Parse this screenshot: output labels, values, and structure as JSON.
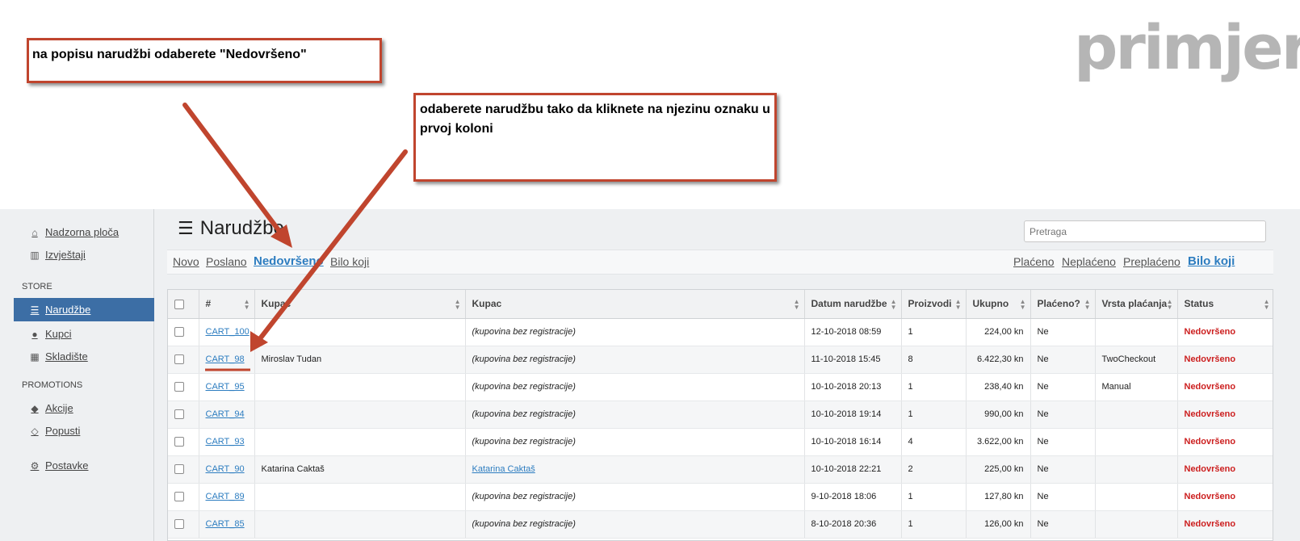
{
  "annotations": {
    "callout_1": "na popisu narudžbi odaberete \"Nedovršeno\"",
    "callout_2": "odaberete narudžbu tako da kliknete na njezinu oznaku u prvoj koloni",
    "watermark": "primjer"
  },
  "sidebar": {
    "items": [
      {
        "label": "Nadzorna ploča",
        "icon": "home-icon"
      },
      {
        "label": "Izvještaji",
        "icon": "bar-chart-icon"
      }
    ],
    "store_title": "STORE",
    "store_items": [
      {
        "label": "Narudžbe",
        "icon": "list-icon",
        "active": true
      },
      {
        "label": "Kupci",
        "icon": "user-icon"
      },
      {
        "label": "Skladište",
        "icon": "cubes-icon"
      }
    ],
    "promotions_title": "PROMOTIONS",
    "promotions_items": [
      {
        "label": "Akcije",
        "icon": "tags-icon"
      },
      {
        "label": "Popusti",
        "icon": "tag-icon"
      }
    ],
    "settings": {
      "label": "Postavke",
      "icon": "gear-icon"
    }
  },
  "header": {
    "title": "Narudžbe",
    "search_placeholder": "Pretraga"
  },
  "filters": {
    "status": [
      "Novo",
      "Poslano",
      "Nedovršeno",
      "Bilo koji"
    ],
    "status_selected": "Nedovršeno",
    "payment": [
      "Plaćeno",
      "Neplaćeno",
      "Preplaćeno",
      "Bilo koji"
    ],
    "payment_selected": "Bilo koji"
  },
  "table": {
    "columns": [
      "#",
      "Kupac",
      "Kupac",
      "Datum narudžbe",
      "Proizvodi",
      "Ukupno",
      "Plaćeno?",
      "Vrsta plaćanja",
      "Status"
    ],
    "rows": [
      {
        "id": "CART_100",
        "customer": "",
        "account": "(kupovina bez registracije)",
        "date": "12-10-2018 08:59",
        "products": "1",
        "total": "224,00 kn",
        "paid": "Ne",
        "payment_type": "",
        "status": "Nedovršeno"
      },
      {
        "id": "CART_98",
        "customer": "Miroslav Tudan",
        "account": "(kupovina bez registracije)",
        "date": "11-10-2018 15:45",
        "products": "8",
        "total": "6.422,30 kn",
        "paid": "Ne",
        "payment_type": "TwoCheckout",
        "status": "Nedovršeno"
      },
      {
        "id": "CART_95",
        "customer": "",
        "account": "(kupovina bez registracije)",
        "date": "10-10-2018 20:13",
        "products": "1",
        "total": "238,40 kn",
        "paid": "Ne",
        "payment_type": "Manual",
        "status": "Nedovršeno"
      },
      {
        "id": "CART_94",
        "customer": "",
        "account": "(kupovina bez registracije)",
        "date": "10-10-2018 19:14",
        "products": "1",
        "total": "990,00 kn",
        "paid": "Ne",
        "payment_type": "",
        "status": "Nedovršeno"
      },
      {
        "id": "CART_93",
        "customer": "",
        "account": "(kupovina bez registracije)",
        "date": "10-10-2018 16:14",
        "products": "4",
        "total": "3.622,00 kn",
        "paid": "Ne",
        "payment_type": "",
        "status": "Nedovršeno"
      },
      {
        "id": "CART_90",
        "customer": "Katarina Caktaš",
        "account": "Katarina Caktaš",
        "account_link": true,
        "date": "10-10-2018 22:21",
        "products": "2",
        "total": "225,00 kn",
        "paid": "Ne",
        "payment_type": "",
        "status": "Nedovršeno"
      },
      {
        "id": "CART_89",
        "customer": "",
        "account": "(kupovina bez registracije)",
        "date": "9-10-2018 18:06",
        "products": "1",
        "total": "127,80 kn",
        "paid": "Ne",
        "payment_type": "",
        "status": "Nedovršeno"
      },
      {
        "id": "CART_85",
        "customer": "",
        "account": "(kupovina bez registracije)",
        "date": "8-10-2018 20:36",
        "products": "1",
        "total": "126,00 kn",
        "paid": "Ne",
        "payment_type": "",
        "status": "Nedovršeno"
      }
    ]
  },
  "colors": {
    "accent": "#3c6ea5",
    "link": "#2d7dc0",
    "status": "#cc1f1f",
    "callout_border": "#c0452e"
  }
}
